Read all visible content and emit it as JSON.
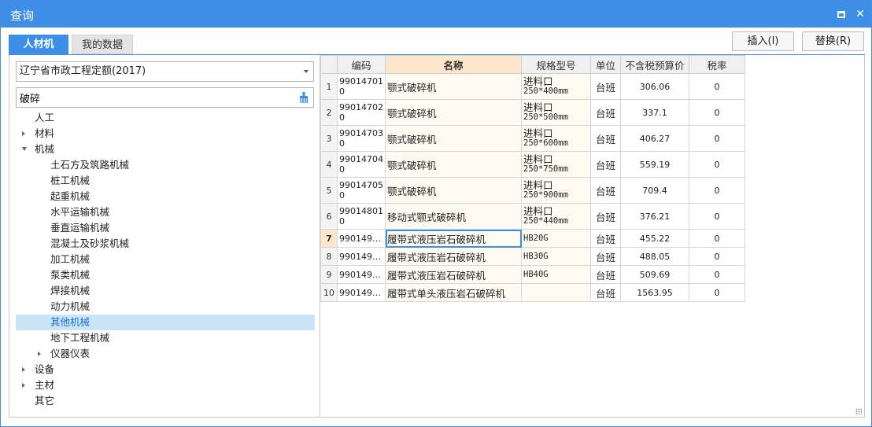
{
  "window": {
    "title": "查询"
  },
  "tabs": [
    {
      "label": "人材机"
    },
    {
      "label": "我的数据"
    }
  ],
  "actions": {
    "insert": "插入(I)",
    "replace": "替换(R)"
  },
  "left": {
    "quota_select": "辽宁省市政工程定额(2017)",
    "search_value": "破碎",
    "tree": [
      {
        "label": "人工",
        "level": 1,
        "expander": "none",
        "selected": false
      },
      {
        "label": "材料",
        "level": 1,
        "expander": "closed",
        "selected": false
      },
      {
        "label": "机械",
        "level": 1,
        "expander": "open",
        "selected": false
      },
      {
        "label": "土石方及筑路机械",
        "level": 2,
        "expander": "none",
        "selected": false
      },
      {
        "label": "桩工机械",
        "level": 2,
        "expander": "none",
        "selected": false
      },
      {
        "label": "起重机械",
        "level": 2,
        "expander": "none",
        "selected": false
      },
      {
        "label": "水平运输机械",
        "level": 2,
        "expander": "none",
        "selected": false
      },
      {
        "label": "垂直运输机械",
        "level": 2,
        "expander": "none",
        "selected": false
      },
      {
        "label": "混凝土及砂浆机械",
        "level": 2,
        "expander": "none",
        "selected": false
      },
      {
        "label": "加工机械",
        "level": 2,
        "expander": "none",
        "selected": false
      },
      {
        "label": "泵类机械",
        "level": 2,
        "expander": "none",
        "selected": false
      },
      {
        "label": "焊接机械",
        "level": 2,
        "expander": "none",
        "selected": false
      },
      {
        "label": "动力机械",
        "level": 2,
        "expander": "none",
        "selected": false
      },
      {
        "label": "其他机械",
        "level": 2,
        "expander": "none",
        "selected": true
      },
      {
        "label": "地下工程机械",
        "level": 2,
        "expander": "none",
        "selected": false
      },
      {
        "label": "仪器仪表",
        "level": 2,
        "expander": "closed",
        "selected": false
      },
      {
        "label": "设备",
        "level": 1,
        "expander": "closed",
        "selected": false
      },
      {
        "label": "主材",
        "level": 1,
        "expander": "closed",
        "selected": false
      },
      {
        "label": "其它",
        "level": 1,
        "expander": "none",
        "selected": false
      }
    ]
  },
  "grid": {
    "columns": [
      {
        "label": ""
      },
      {
        "label": "编码"
      },
      {
        "label": "名称"
      },
      {
        "label": "规格型号"
      },
      {
        "label": "单位"
      },
      {
        "label": "不含税预算价"
      },
      {
        "label": "税率"
      }
    ],
    "rows": [
      {
        "no": "1",
        "code_a": "99014701",
        "code_b": "0",
        "name": "颚式破碎机",
        "spec_a": "进料口",
        "spec_b": "250*400mm",
        "unit": "台班",
        "price": "306.06",
        "tax": "0"
      },
      {
        "no": "2",
        "code_a": "99014702",
        "code_b": "0",
        "name": "颚式破碎机",
        "spec_a": "进料口",
        "spec_b": "250*500mm",
        "unit": "台班",
        "price": "337.1",
        "tax": "0"
      },
      {
        "no": "3",
        "code_a": "99014703",
        "code_b": "0",
        "name": "颚式破碎机",
        "spec_a": "进料口",
        "spec_b": "250*600mm",
        "unit": "台班",
        "price": "406.27",
        "tax": "0"
      },
      {
        "no": "4",
        "code_a": "99014704",
        "code_b": "0",
        "name": "颚式破碎机",
        "spec_a": "进料口",
        "spec_b": "250*750mm",
        "unit": "台班",
        "price": "559.19",
        "tax": "0"
      },
      {
        "no": "5",
        "code_a": "99014705",
        "code_b": "0",
        "name": "颚式破碎机",
        "spec_a": "进料口",
        "spec_b": "250*900mm",
        "unit": "台班",
        "price": "709.4",
        "tax": "0"
      },
      {
        "no": "6",
        "code_a": "99014801",
        "code_b": "0",
        "name": "移动式颚式破碎机",
        "spec_a": "进料口",
        "spec_b": "250*440mm",
        "unit": "台班",
        "price": "376.21",
        "tax": "0"
      },
      {
        "no": "7",
        "code": "990149…",
        "name": "履带式液压岩石破碎机",
        "spec": "HB20G",
        "unit": "台班",
        "price": "455.22",
        "tax": "0"
      },
      {
        "no": "8",
        "code": "990149…",
        "name": "履带式液压岩石破碎机",
        "spec": "HB30G",
        "unit": "台班",
        "price": "488.05",
        "tax": "0"
      },
      {
        "no": "9",
        "code": "990149…",
        "name": "履带式液压岩石破碎机",
        "spec": "HB40G",
        "unit": "台班",
        "price": "509.69",
        "tax": "0"
      },
      {
        "no": "10",
        "code": "990149…",
        "name": "履带式单头液压岩石破碎机",
        "spec": "",
        "unit": "台班",
        "price": "1563.95",
        "tax": "0"
      }
    ]
  }
}
